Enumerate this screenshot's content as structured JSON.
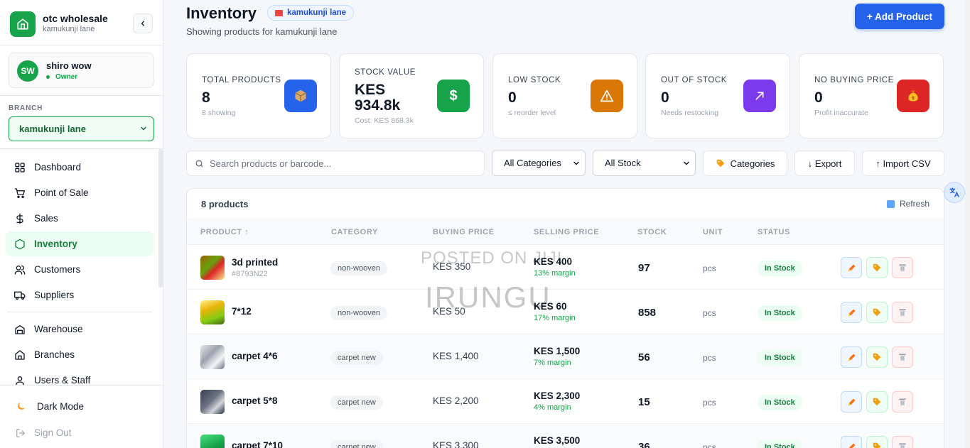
{
  "sidebar": {
    "brand_name": "otc wholesale",
    "brand_sub": "kamukunji lane",
    "user_initials": "SW",
    "user_name": "shiro wow",
    "user_role": "Owner",
    "branch_label": "BRANCH",
    "branch_value": "kamukunji lane",
    "nav": [
      {
        "label": "Dashboard",
        "icon": "grid-icon"
      },
      {
        "label": "Point of Sale",
        "icon": "cart-icon"
      },
      {
        "label": "Sales",
        "icon": "dollar-icon"
      },
      {
        "label": "Inventory",
        "icon": "hexagon-icon",
        "active": true
      },
      {
        "label": "Customers",
        "icon": "users-icon"
      },
      {
        "label": "Suppliers",
        "icon": "truck-icon"
      },
      {
        "label": "Warehouse",
        "icon": "warehouse-icon"
      },
      {
        "label": "Branches",
        "icon": "home-icon"
      },
      {
        "label": "Users & Staff",
        "icon": "user-icon"
      }
    ],
    "dark_mode": "Dark Mode",
    "sign_out": "Sign Out"
  },
  "header": {
    "title": "Inventory",
    "branch_badge": "kamukunji lane",
    "subtitle": "Showing products for kamukunji lane",
    "add_button": "+ Add Product"
  },
  "stats": [
    {
      "label": "TOTAL PRODUCTS",
      "value": "8",
      "sub": "8 showing",
      "icon": "box-icon",
      "color": "#2563eb"
    },
    {
      "label": "STOCK VALUE",
      "value_line1": "KES",
      "value_line2": "934.8k",
      "sub": "Cost: KES 868.3k",
      "icon": "dollar-icon",
      "color": "#16a34a"
    },
    {
      "label": "LOW STOCK",
      "value": "0",
      "sub": "≤ reorder level",
      "icon": "warning-icon",
      "color": "#d97706"
    },
    {
      "label": "OUT OF STOCK",
      "value": "0",
      "sub": "Needs restocking",
      "icon": "trend-icon",
      "color": "#7c3aed"
    },
    {
      "label": "NO BUYING PRICE",
      "value": "0",
      "sub": "Profit inaccurate",
      "icon": "moneybag-icon",
      "color": "#dc2626"
    }
  ],
  "toolbar": {
    "search_placeholder": "Search products or barcode...",
    "category_select": "All Categories",
    "stock_select": "All Stock",
    "categories_button": "Categories",
    "export_button": "↓ Export",
    "import_button": "↑ Import CSV"
  },
  "table": {
    "count_label": "8 products",
    "refresh_label": "Refresh",
    "columns": [
      "PRODUCT ↑",
      "CATEGORY",
      "BUYING PRICE",
      "SELLING PRICE",
      "STOCK",
      "UNIT",
      "STATUS"
    ],
    "rows": [
      {
        "name": "3d printed",
        "sku": "#8793N22",
        "category": "non-wooven",
        "buying": "KES 350",
        "selling": "KES 400",
        "margin": "13% margin",
        "stock": "97",
        "unit": "pcs",
        "status": "In Stock"
      },
      {
        "name": "7*12",
        "sku": "",
        "category": "non-wooven",
        "buying": "KES 50",
        "selling": "KES 60",
        "margin": "17% margin",
        "stock": "858",
        "unit": "pcs",
        "status": "In Stock"
      },
      {
        "name": "carpet 4*6",
        "sku": "",
        "category": "carpet new",
        "buying": "KES 1,400",
        "selling": "KES 1,500",
        "margin": "7% margin",
        "stock": "56",
        "unit": "pcs",
        "status": "In Stock"
      },
      {
        "name": "carpet 5*8",
        "sku": "",
        "category": "carpet new",
        "buying": "KES 2,200",
        "selling": "KES 2,300",
        "margin": "4% margin",
        "stock": "15",
        "unit": "pcs",
        "status": "In Stock"
      },
      {
        "name": "carpet 7*10",
        "sku": "",
        "category": "carpet new",
        "buying": "KES 3,300",
        "selling": "KES 3,500",
        "margin": "",
        "stock": "36",
        "unit": "pcs",
        "status": "In Stock"
      }
    ]
  },
  "watermark": {
    "line1": "POSTED ON JIJI",
    "line2": "IRUNGU"
  }
}
